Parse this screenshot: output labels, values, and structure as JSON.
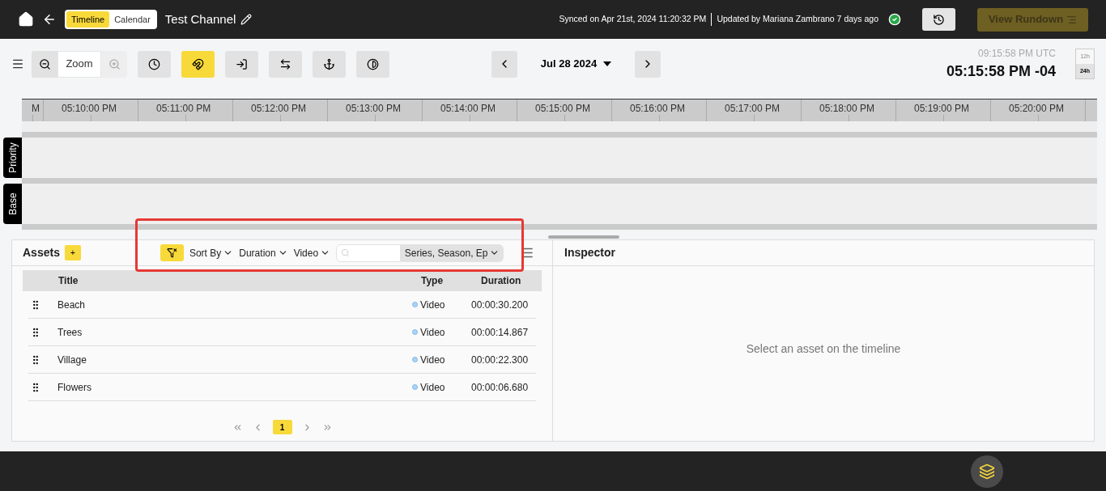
{
  "header": {
    "view_toggle": [
      {
        "label": "Timeline",
        "selected": true
      },
      {
        "label": "Calendar",
        "selected": false
      }
    ],
    "channel_title": "Test Channel",
    "sync_status": "Synced on Apr 21st, 2024 11:20:32 PM",
    "updated_status": "Updated by Mariana Zambrano 7 days ago",
    "view_rundown": {
      "label": "View Rundown",
      "disabled": true
    }
  },
  "toolbar": {
    "zoom_label": "Zoom",
    "zoom_in_disabled": true,
    "tools": [
      {
        "kind": "clock",
        "active": false
      },
      {
        "kind": "magnet",
        "active": true
      },
      {
        "kind": "login",
        "active": false
      },
      {
        "kind": "swap",
        "active": false
      },
      {
        "kind": "anchor",
        "active": false
      },
      {
        "kind": "contrast",
        "active": false
      }
    ],
    "date": "Jul 28 2024",
    "utc_time": "09:15:58 PM UTC",
    "local_time": "05:15:58 PM -04",
    "clock_format": [
      {
        "label": "12h",
        "selected": false
      },
      {
        "label": "24h",
        "selected": true
      }
    ]
  },
  "timeline": {
    "ticks": [
      "M",
      "05:10:00 PM",
      "05:11:00 PM",
      "05:12:00 PM",
      "05:13:00 PM",
      "05:14:00 PM",
      "05:15:00 PM",
      "05:16:00 PM",
      "05:17:00 PM",
      "05:18:00 PM",
      "05:19:00 PM",
      "05:20:00 PM"
    ],
    "tracks": [
      "Priority",
      "Base"
    ]
  },
  "assets": {
    "title": "Assets",
    "add_label": "+",
    "filters": [
      "Sort By",
      "Duration",
      "Video"
    ],
    "field_select": "Series, Season, Ep",
    "columns": [
      "Title",
      "Type",
      "Duration"
    ],
    "rows": [
      {
        "title": "Beach",
        "type": "Video",
        "duration": "00:00:30.200"
      },
      {
        "title": "Trees",
        "type": "Video",
        "duration": "00:00:14.867"
      },
      {
        "title": "Village",
        "type": "Video",
        "duration": "00:00:22.300"
      },
      {
        "title": "Flowers",
        "type": "Video",
        "duration": "00:00:06.680"
      }
    ],
    "pages": [
      {
        "label": "1",
        "selected": true
      }
    ]
  },
  "inspector": {
    "title": "Inspector",
    "empty_message": "Select an asset on the timeline"
  }
}
